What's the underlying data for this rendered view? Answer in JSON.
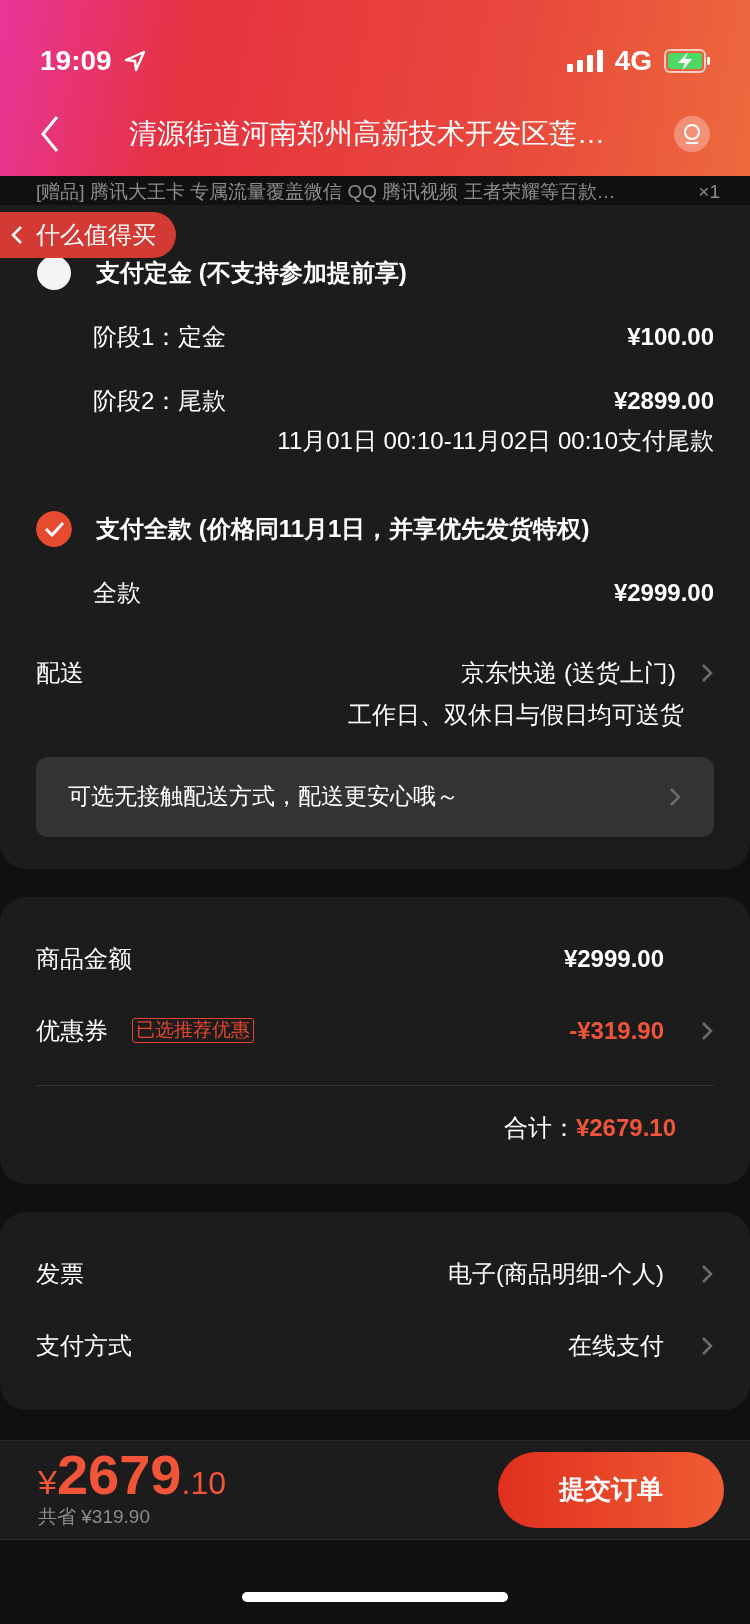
{
  "status_bar": {
    "time": "19:09",
    "network": "4G"
  },
  "header": {
    "title": "清源街道河南郑州高新技术开发区莲…"
  },
  "gift": {
    "text": "[赠品] 腾讯大王卡 专属流量覆盖微信 QQ 腾讯视频 王者荣耀等百款…",
    "qty": "×1"
  },
  "float_button": {
    "label": "什么值得买"
  },
  "payment_options": [
    {
      "label": "支付定金 (不支持参加提前享)",
      "selected": false,
      "lines": [
        {
          "label": "阶段1：定金",
          "value": "¥100.00"
        },
        {
          "label": "阶段2：尾款",
          "value": "¥2899.00",
          "note": "11月01日 00:10-11月02日 00:10支付尾款"
        }
      ]
    },
    {
      "label": "支付全款 (价格同11月1日，并享优先发货特权)",
      "selected": true,
      "lines": [
        {
          "label": "全款",
          "value": "¥2999.00"
        }
      ]
    }
  ],
  "delivery": {
    "label": "配送",
    "value": "京东快递 (送货上门)",
    "note": "工作日、双休日与假日均可送货"
  },
  "notice": "可选无接触配送方式，配送更安心哦～",
  "summary": {
    "rows": [
      {
        "label": "商品金额",
        "value": "¥2999.00",
        "highlight": false,
        "arrow": false
      },
      {
        "label": "优惠券",
        "tag": "已选推荐优惠",
        "value": "-¥319.90",
        "highlight": true,
        "arrow": true
      }
    ],
    "total_label": "合计：",
    "total": "¥2679.10"
  },
  "settings": [
    {
      "label": "发票",
      "value": "电子(商品明细-个人)"
    },
    {
      "label": "支付方式",
      "value": "在线支付"
    }
  ],
  "bottom_bar": {
    "currency": "¥",
    "price_int": "2679",
    "price_dec": ".10",
    "saved": "共省 ¥319.90",
    "submit": "提交订单"
  }
}
